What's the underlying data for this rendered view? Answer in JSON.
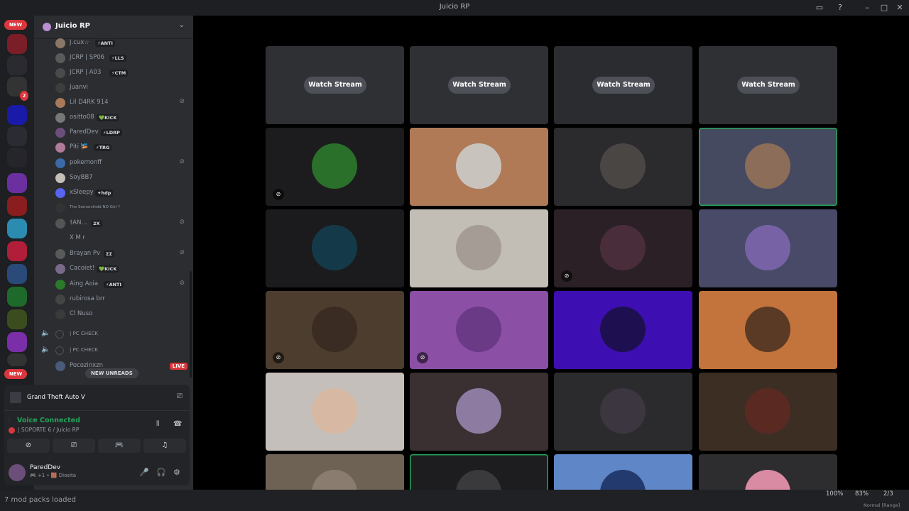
{
  "window": {
    "title": "Juicio RP"
  },
  "servers": {
    "new_label_top": "NEW",
    "new_label_bottom": "NEW",
    "badge": "2"
  },
  "guild": {
    "name": "Juicio RP"
  },
  "members": [
    {
      "name": "J.cux☆",
      "tag": "⚡ANTI"
    },
    {
      "name": "JCRP | SP06",
      "tag": "⚡LLS"
    },
    {
      "name": "JCRP | A03",
      "tag": "⚡CTM"
    },
    {
      "name": "Juanvi",
      "tag": ""
    },
    {
      "name": "Lil D4RK 914",
      "tag": ""
    },
    {
      "name": "ositto08",
      "tag": "💚KICK"
    },
    {
      "name": "ParedDev",
      "tag": "⚡LDRP"
    },
    {
      "name": "Piti 🎏",
      "tag": "⚡TRG"
    },
    {
      "name": "pokemonff",
      "tag": ""
    },
    {
      "name": "SoyBB7",
      "tag": ""
    },
    {
      "name": "xSleepy",
      "tag": "✦hdp"
    },
    {
      "name": "The Somorchidd NO Girl ?",
      "tag": ""
    },
    {
      "name": "†AN...",
      "tag": "2X"
    },
    {
      "name": "X M r",
      "tag": ""
    },
    {
      "name": "Brayan Pv",
      "tag": "ΣΣ"
    },
    {
      "name": "Cacoiet!",
      "tag": "💚KICK"
    },
    {
      "name": "Aing Aoia",
      "tag": "⚡ANTI"
    },
    {
      "name": "rubirosa brr",
      "tag": ""
    },
    {
      "name": "Cl Nuso",
      "tag": ""
    }
  ],
  "voice_channels": [
    {
      "name": "| PC CHECK"
    },
    {
      "name": "| PC CHECK"
    }
  ],
  "live_user": {
    "name": "Pocozinxzn",
    "live": "LIVE"
  },
  "new_unreads": "NEW UNREADS",
  "activity": {
    "game": "Grand Theft Auto V"
  },
  "voice": {
    "status": "Voice Connected",
    "channel": "| SOPORTE 6 / Juicio RP"
  },
  "user": {
    "name": "ParedDev",
    "status": "🎮 +1 • 🟫 Diosita"
  },
  "stage": {
    "watch_label": "Watch Stream"
  },
  "tiles": [
    {
      "type": "stream",
      "bg": "#2f3034"
    },
    {
      "type": "stream",
      "bg": "#2f3034"
    },
    {
      "type": "stream",
      "bg": "#2b2c30"
    },
    {
      "type": "stream",
      "bg": "#2f3034"
    },
    {
      "type": "user",
      "bg": "#1c1c1e",
      "av": "#2a6f2a",
      "muted": true
    },
    {
      "type": "user",
      "bg": "#b07a57",
      "av": "#c9c3bd"
    },
    {
      "type": "user",
      "bg": "#2b2b2d",
      "av": "#4a4644"
    },
    {
      "type": "user",
      "bg": "#464a60",
      "av": "#8b6d5a",
      "speaking": true
    },
    {
      "type": "user",
      "bg": "#1b1b1d",
      "av": "#143a4a"
    },
    {
      "type": "user",
      "bg": "#c2bdb5",
      "av": "#a59c95"
    },
    {
      "type": "user",
      "bg": "#2a2025",
      "av": "#4a2d3a",
      "muted": true
    },
    {
      "type": "user",
      "bg": "#484a68",
      "av": "#7762a5"
    },
    {
      "type": "user",
      "bg": "#4d3d2e",
      "av": "#3a2c22",
      "muted": true
    },
    {
      "type": "user",
      "bg": "#8b4fa6",
      "av": "#6b3a86",
      "muted": true
    },
    {
      "type": "user",
      "bg": "#3d0fb2",
      "av": "#1e1050"
    },
    {
      "type": "user",
      "bg": "#c2743c",
      "av": "#5b3a25"
    },
    {
      "type": "user",
      "bg": "#c4bfba",
      "av": "#d7b9a3"
    },
    {
      "type": "user",
      "bg": "#3a2f31",
      "av": "#8d7ba1"
    },
    {
      "type": "user",
      "bg": "#2b2b2d",
      "av": "#3c3640"
    },
    {
      "type": "user",
      "bg": "#3d2e23",
      "av": "#5a2a22"
    },
    {
      "type": "user",
      "bg": "#6e6254",
      "av": "#8a7d70"
    },
    {
      "type": "user",
      "bg": "#1d1d1f",
      "av": "#3a3a3c",
      "speaking": true
    },
    {
      "type": "user",
      "bg": "#5f86c7",
      "av": "#233a6e"
    },
    {
      "type": "user",
      "bg": "#2d2d2f",
      "av": "#d98ba3"
    }
  ],
  "statusbar": {
    "mods": "7 mod packs loaded",
    "zoom1": "100%",
    "zoom2": "83%",
    "page": "2/3",
    "mode": "Normal [Range]"
  }
}
